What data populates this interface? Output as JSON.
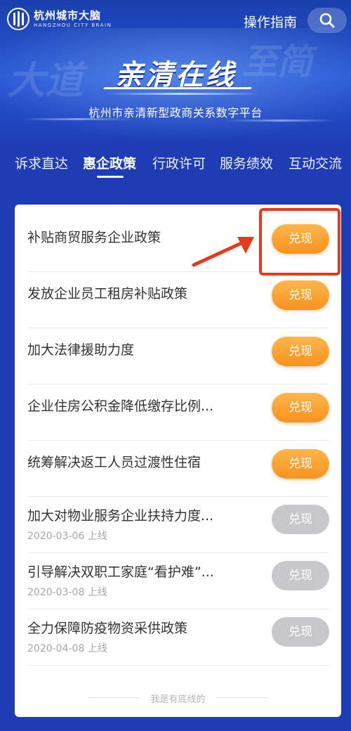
{
  "brand": {
    "name_cn": "杭州城市大脑",
    "name_en": "HANGZHOU CITY BRAIN"
  },
  "header": {
    "guide_label": "操作指南",
    "search_icon": "search-icon",
    "title": "亲清在线",
    "subtitle": "杭州市亲清新型政商关系数字平台"
  },
  "tabs": [
    {
      "label": "诉求直达",
      "active": false
    },
    {
      "label": "惠企政策",
      "active": true
    },
    {
      "label": "行政许可",
      "active": false
    },
    {
      "label": "服务绩效",
      "active": false
    },
    {
      "label": "互动交流",
      "active": false
    }
  ],
  "policies": [
    {
      "title": "补贴商贸服务企业政策",
      "date": "",
      "button": "兑现",
      "enabled": true
    },
    {
      "title": "发放企业员工租房补贴政策",
      "date": "",
      "button": "兑现",
      "enabled": true
    },
    {
      "title": "加大法律援助力度",
      "date": "",
      "button": "兑现",
      "enabled": true
    },
    {
      "title": "企业住房公积金降低缴存比例...",
      "date": "",
      "button": "兑现",
      "enabled": true
    },
    {
      "title": "统筹解决返工人员过渡性住宿",
      "date": "",
      "button": "兑现",
      "enabled": true
    },
    {
      "title": "加大对物业服务企业扶持力度...",
      "date": "2020-03-06 上线",
      "button": "兑现",
      "enabled": false
    },
    {
      "title": "引导解决双职工家庭“看护难”...",
      "date": "2020-03-08 上线",
      "button": "兑现",
      "enabled": false
    },
    {
      "title": "全力保障防疫物资采供政策",
      "date": "2020-04-08 上线",
      "button": "兑现",
      "enabled": false
    }
  ],
  "footer_text": "我是有底线的",
  "colors": {
    "primary_blue": "#1e3cb3",
    "button_orange": "#f7921e",
    "button_disabled": "#c8c8cc",
    "annotation_red": "#e8391c"
  }
}
